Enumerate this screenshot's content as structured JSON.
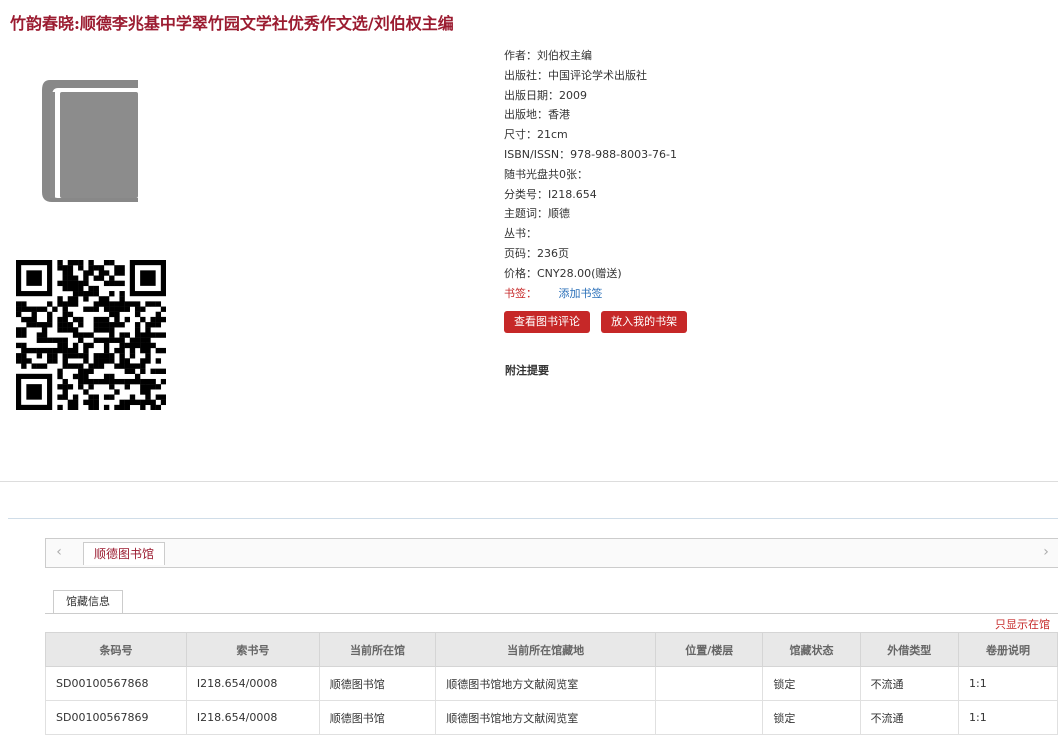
{
  "book": {
    "title": "竹韵春晓:顺德李兆基中学翠竹园文学社优秀作文选/刘伯权主编",
    "meta": [
      "作者：刘伯权主编",
      "出版社：中国评论学术出版社",
      "出版日期：2009",
      "出版地：香港",
      "尺寸：21cm",
      "ISBN/ISSN：978-988-8003-76-1",
      "随书光盘共0张：",
      "分类号：I218.654",
      "主题词：顺德",
      "丛书：",
      "页码：236页",
      "价格：CNY28.00(赠送)"
    ],
    "bookmark_label": "书签：",
    "bookmark_link": "添加书签",
    "btn_review": "查看图书评论",
    "btn_shelf": "放入我的书架",
    "note_label": "附注提要"
  },
  "holdings": {
    "library_tab": "顺德图书馆",
    "subtab": "馆藏信息",
    "only_show": "只显示在馆",
    "columns": [
      "条码号",
      "索书号",
      "当前所在馆",
      "当前所在馆藏地",
      "位置/楼层",
      "馆藏状态",
      "外借类型",
      "卷册说明"
    ],
    "rows": [
      [
        "SD00100567868",
        "I218.654/0008",
        "顺德图书馆",
        "顺德图书馆地方文献阅览室",
        "",
        "锁定",
        "不流通",
        "1:1"
      ],
      [
        "SD00100567869",
        "I218.654/0008",
        "顺德图书馆",
        "顺德图书馆地方文献阅览室",
        "",
        "锁定",
        "不流通",
        "1:1"
      ]
    ]
  },
  "icons": {
    "cover": "book-icon",
    "qr": "qr-code",
    "prev": "chevron-left-icon",
    "next": "chevron-right-icon"
  },
  "colors": {
    "accent": "#c62828",
    "title": "#9b1b30",
    "link": "#2a6fb8"
  }
}
